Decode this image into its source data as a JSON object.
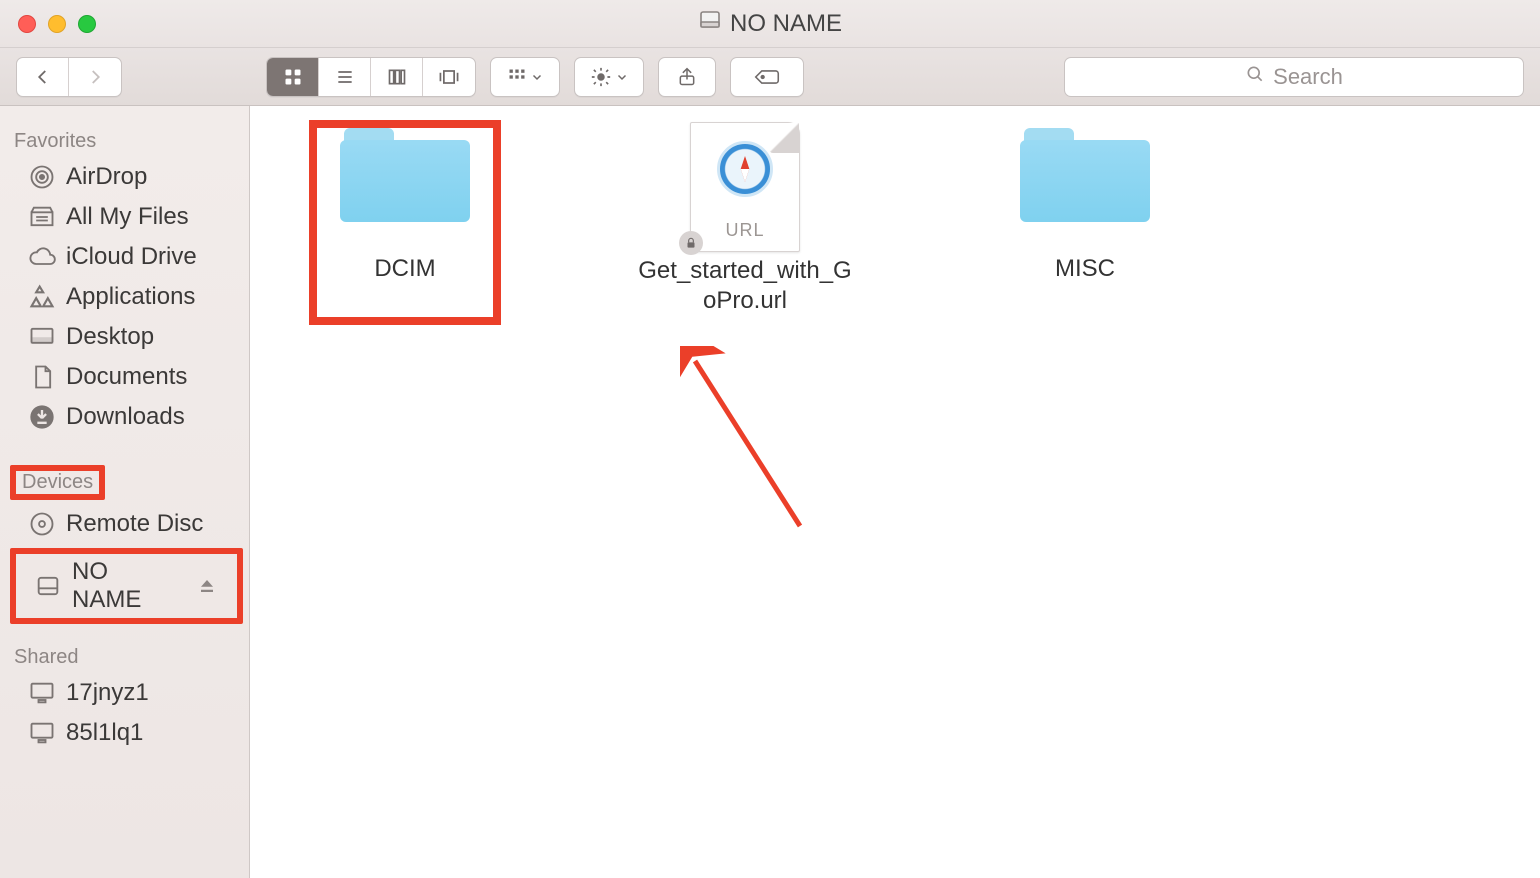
{
  "window": {
    "title": "NO NAME"
  },
  "search": {
    "placeholder": "Search"
  },
  "sidebar": {
    "sections": {
      "favorites": {
        "label": "Favorites",
        "items": [
          {
            "label": "AirDrop",
            "icon": "airdrop-icon"
          },
          {
            "label": "All My Files",
            "icon": "allfiles-icon"
          },
          {
            "label": "iCloud Drive",
            "icon": "cloud-icon"
          },
          {
            "label": "Applications",
            "icon": "apps-icon"
          },
          {
            "label": "Desktop",
            "icon": "desktop-icon"
          },
          {
            "label": "Documents",
            "icon": "documents-icon"
          },
          {
            "label": "Downloads",
            "icon": "downloads-icon"
          }
        ]
      },
      "devices": {
        "label": "Devices",
        "items": [
          {
            "label": "Remote Disc",
            "icon": "disc-icon"
          },
          {
            "label": "NO NAME",
            "icon": "drive-icon",
            "ejectable": true,
            "selected": true
          }
        ]
      },
      "shared": {
        "label": "Shared",
        "items": [
          {
            "label": "17jnyz1",
            "icon": "computer-icon"
          },
          {
            "label": "85l1lq1",
            "icon": "computer-icon"
          }
        ]
      }
    }
  },
  "files": [
    {
      "name": "DCIM",
      "type": "folder",
      "highlighted": true
    },
    {
      "name": "Get_started_with_GoPro.url",
      "type": "url",
      "badge_text": "URL"
    },
    {
      "name": "MISC",
      "type": "folder"
    }
  ],
  "annotations": {
    "highlight_color": "#eb3f29"
  }
}
